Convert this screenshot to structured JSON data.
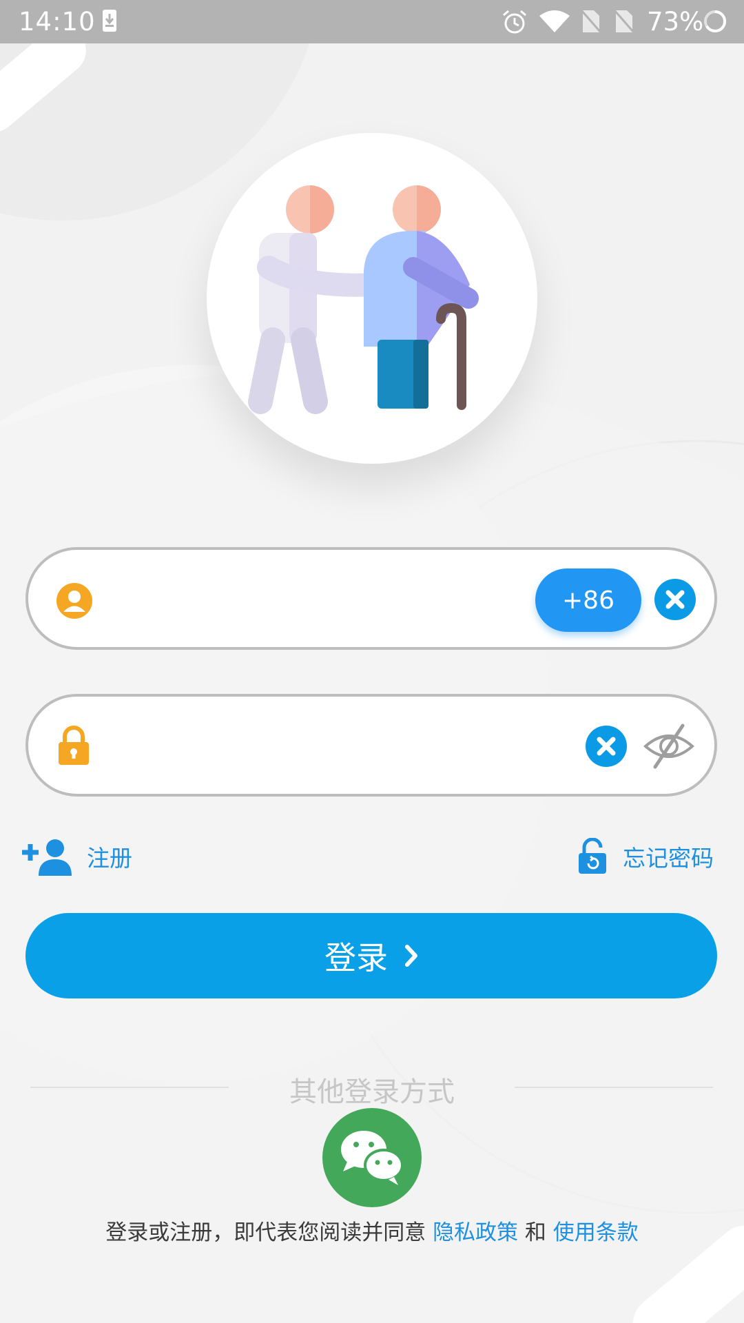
{
  "status_bar": {
    "time": "14:10",
    "battery": "73%",
    "icons": [
      "download-icon",
      "alarm-icon",
      "wifi-icon",
      "no-sim-icon",
      "no-sim-icon",
      "battery-icon"
    ]
  },
  "avatar": {
    "icon": "elderly-care-icon"
  },
  "phone_field": {
    "value": "",
    "placeholder": "",
    "icon": "user-icon",
    "country_code": "+86",
    "icon_color": "#f5a623"
  },
  "password_field": {
    "value": "",
    "placeholder": "",
    "icon": "lock-icon"
  },
  "links": {
    "register": "注册",
    "forgot_password": "忘记密码"
  },
  "login_button": {
    "label": "登录"
  },
  "other_login": {
    "label": "其他登录方式",
    "icon": "wechat-icon"
  },
  "agreement": {
    "prefix": "登录或注册，即代表您阅读并同意",
    "privacy_link": "隐私政策",
    "conjunction": "和",
    "terms_link": "使用条款"
  },
  "colors": {
    "accent": "#0aa0e8",
    "country_code_bg": "#2196f3",
    "link": "#1e90e0",
    "wechat": "#43a85a",
    "status_bar": "#b3b3b3"
  }
}
